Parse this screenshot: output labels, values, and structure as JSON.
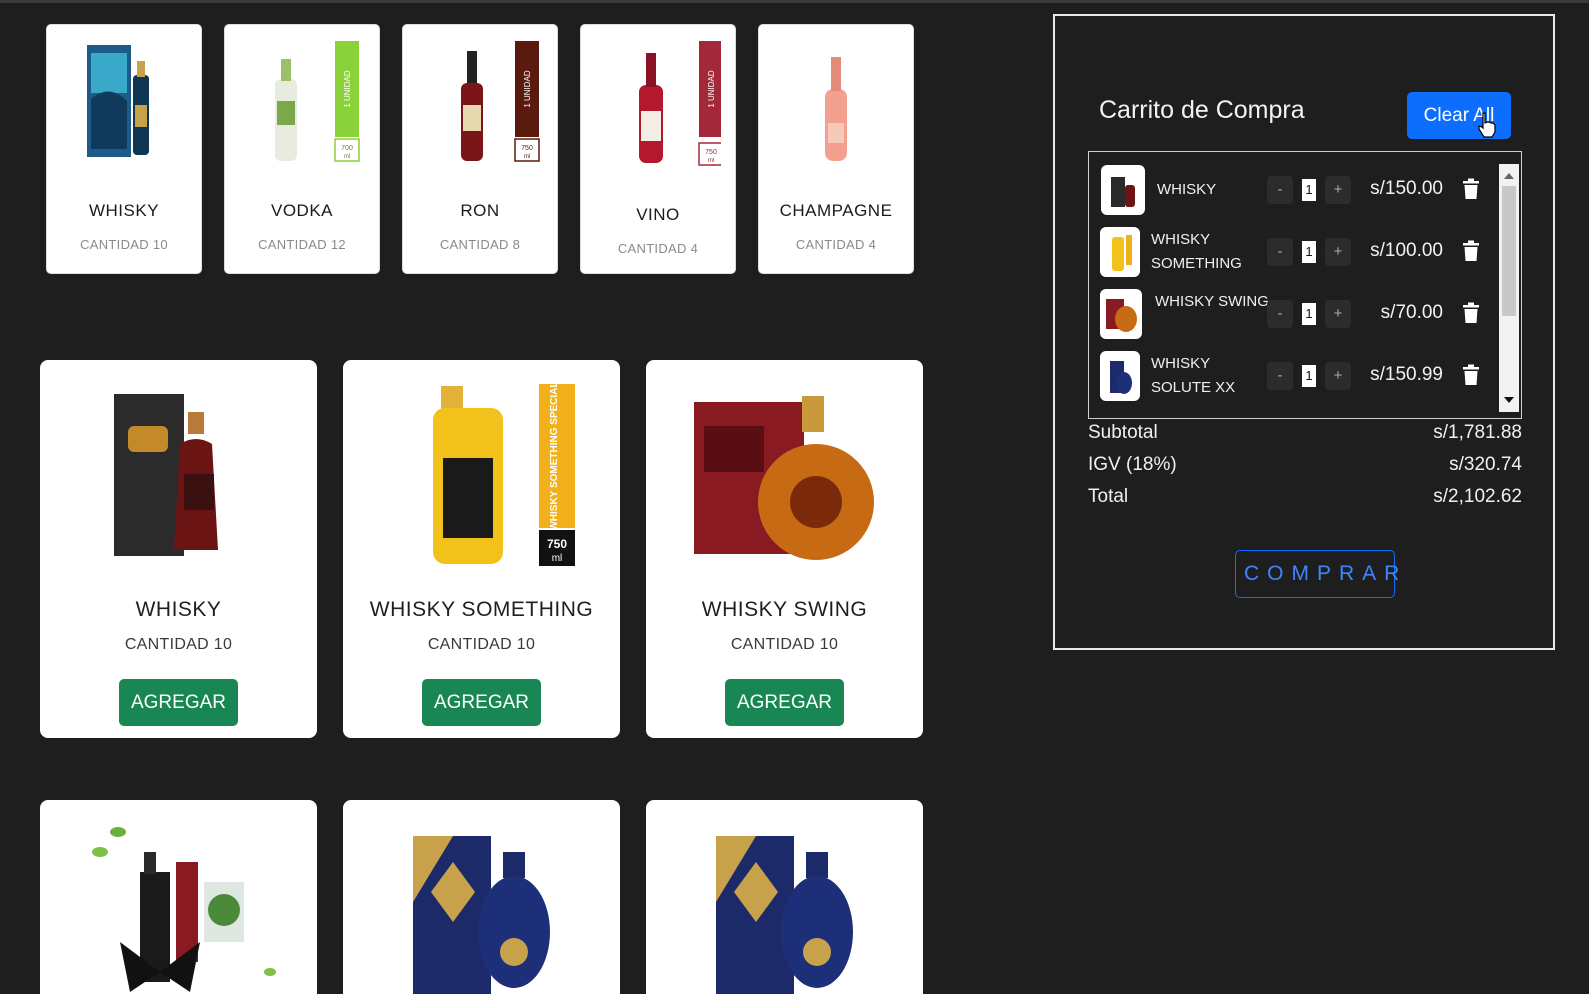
{
  "categories": [
    {
      "name": "WHISKY",
      "quantity": "CANTIDAD 10"
    },
    {
      "name": "VODKA",
      "quantity": "CANTIDAD 12"
    },
    {
      "name": "RON",
      "quantity": "CANTIDAD 8"
    },
    {
      "name": "VINO",
      "quantity": "CANTIDAD 4"
    },
    {
      "name": "CHAMPAGNE",
      "quantity": "CANTIDAD 4"
    }
  ],
  "labels": {
    "unit": "1 UNIDAD",
    "vol_700": "700",
    "vol_750": "750",
    "ml": "ml",
    "whisky_special": "WHISKY SOMETHING SPECIAL"
  },
  "products": [
    {
      "name": "WHISKY",
      "quantity": "CANTIDAD 10",
      "button": "AGREGAR"
    },
    {
      "name": "WHISKY SOMETHING",
      "quantity": "CANTIDAD 10",
      "button": "AGREGAR"
    },
    {
      "name": "WHISKY SWING",
      "quantity": "CANTIDAD 10",
      "button": "AGREGAR"
    }
  ],
  "cart": {
    "title": "Carrito de Compra",
    "clear_label": "Clear All",
    "items": [
      {
        "name": "WHISKY",
        "qty": "1",
        "price": "s/150.00"
      },
      {
        "name": "WHISKY SOMETHING",
        "qty": "1",
        "price": "s/100.00"
      },
      {
        "name": "WHISKY SWING",
        "qty": "1",
        "price": "s/70.00"
      },
      {
        "name": "WHISKY SOLUTE XX",
        "qty": "1",
        "price": "s/150.99"
      }
    ],
    "minus": "-",
    "plus": "+",
    "subtotal_label": "Subtotal",
    "subtotal_value": "s/1,781.88",
    "igv_label": "IGV (18%)",
    "igv_value": "s/320.74",
    "total_label": "Total",
    "total_value": "s/2,102.62",
    "buy_label": "COMPRAR"
  },
  "colors": {
    "background": "#1e1e1e",
    "add_button": "#198754",
    "primary": "#0d6efd"
  }
}
